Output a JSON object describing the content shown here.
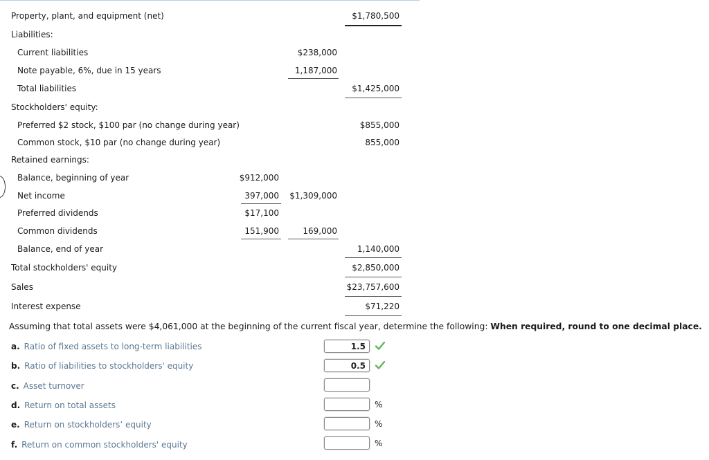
{
  "statement": {
    "ppe": {
      "label": "Property, plant, and equipment (net)",
      "amount": "$1,780,500"
    },
    "liabilities": {
      "heading": "Liabilities:",
      "current": {
        "label": "Current liabilities",
        "amount": "$238,000"
      },
      "note": {
        "label": "Note payable, 6%, due in 15 years",
        "amount": "1,187,000"
      },
      "total": {
        "label": "Total liabilities",
        "amount": "$1,425,000"
      }
    },
    "equity": {
      "heading": "Stockholders' equity:",
      "preferred": {
        "label": "Preferred $2 stock, $100 par (no change during year)",
        "amount": "$855,000"
      },
      "common": {
        "label": "Common stock, $10 par (no change during year)",
        "amount": "855,000"
      }
    },
    "retained": {
      "heading": "Retained earnings:",
      "begin": {
        "label": "Balance, beginning of year",
        "amount": "$912,000"
      },
      "net_income": {
        "label": "Net income",
        "amount": "397,000",
        "subtotal": "$1,309,000"
      },
      "pref_div": {
        "label": "Preferred dividends",
        "amount": "$17,100"
      },
      "common_div": {
        "label": "Common dividends",
        "amount": "151,900",
        "subtotal": "169,000"
      },
      "end": {
        "label": "Balance, end of year",
        "amount": "1,140,000"
      }
    },
    "total_equity": {
      "label": "Total stockholders' equity",
      "amount": "$2,850,000"
    },
    "sales": {
      "label": "Sales",
      "amount": "$23,757,600"
    },
    "interest": {
      "label": "Interest expense",
      "amount": "$71,220"
    }
  },
  "instructions": {
    "text": "Assuming that total assets were $4,061,000 at the beginning of the current fiscal year, determine the following:",
    "bold": "When required, round to one decimal place."
  },
  "questions": [
    {
      "letter": "a.",
      "label": "Ratio of fixed assets to long-term liabilities",
      "value": "1.5",
      "unit": "",
      "status": "correct"
    },
    {
      "letter": "b.",
      "label": "Ratio of liabilities to stockholders' equity",
      "value": "0.5",
      "unit": "",
      "status": "correct"
    },
    {
      "letter": "c.",
      "label": "Asset turnover",
      "value": "",
      "unit": "",
      "status": "none"
    },
    {
      "letter": "d.",
      "label": "Return on total assets",
      "value": "",
      "unit": "%",
      "status": "none"
    },
    {
      "letter": "e.",
      "label": "Return on stockholders’ equity",
      "value": "",
      "unit": "%",
      "status": "none"
    },
    {
      "letter": "f.",
      "label": "Return on common stockholders' equity",
      "value": "",
      "unit": "%",
      "status": "none"
    }
  ],
  "colors": {
    "check": "#5cb85c",
    "question_text": "#5b7893"
  },
  "icons": {
    "correct": "checkmark-icon"
  }
}
